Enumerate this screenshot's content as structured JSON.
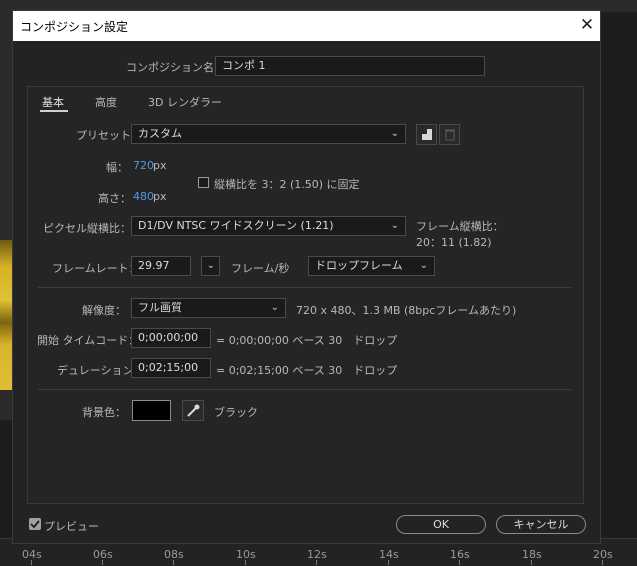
{
  "dialog": {
    "title": "コンポジション設定",
    "close_label": "✕"
  },
  "comp_name": {
    "label": "コンポジション名：",
    "value": "コンポ 1"
  },
  "tabs": [
    {
      "label": "基本",
      "active": true
    },
    {
      "label": "高度",
      "active": false
    },
    {
      "label": "3D レンダラー",
      "active": false
    }
  ],
  "preset": {
    "label": "プリセット：",
    "value": "カスタム"
  },
  "width": {
    "label": "幅：",
    "value": "720",
    "unit": "px"
  },
  "height": {
    "label": "高さ：",
    "value": "480",
    "unit": "px"
  },
  "lock_aspect": {
    "label": "縦横比を 3：2 (1.50) に固定",
    "checked": false
  },
  "pixel_aspect": {
    "label": "ピクセル縦横比：",
    "value": "D1/DV NTSC ワイドスクリーン (1.21)"
  },
  "frame_aspect": {
    "label": "フレーム縦横比：",
    "value": "20：11 (1.82)"
  },
  "frame_rate": {
    "label": "フレームレート：",
    "value": "29.97",
    "unit": "フレーム/秒",
    "dropframe": "ドロップフレーム"
  },
  "resolution": {
    "label": "解像度：",
    "value": "フル画質",
    "info": "720 x 480、1.3 MB (8bpcフレームあたり)"
  },
  "start_timecode": {
    "label": "開始 タイムコード：",
    "value": "0;00;00;00",
    "info": "= 0;00;00;00 ベース 30　ドロップ"
  },
  "duration": {
    "label": "デュレーション：",
    "value": "0;02;15;00",
    "info": "= 0;02;15;00 ベース 30　ドロップ"
  },
  "bg_color": {
    "label": "背景色：",
    "swatch": "#000000",
    "name": "ブラック"
  },
  "preview": {
    "label": "プレビュー",
    "checked": true
  },
  "buttons": {
    "ok": "OK",
    "cancel": "キャンセル"
  },
  "timeline": {
    "ticks": [
      "04s",
      "06s",
      "08s",
      "10s",
      "12s",
      "14s",
      "16s",
      "18s",
      "20s"
    ]
  },
  "colors": {
    "accent_blue": "#4a9ae5",
    "dialog_bg": "#232323"
  }
}
